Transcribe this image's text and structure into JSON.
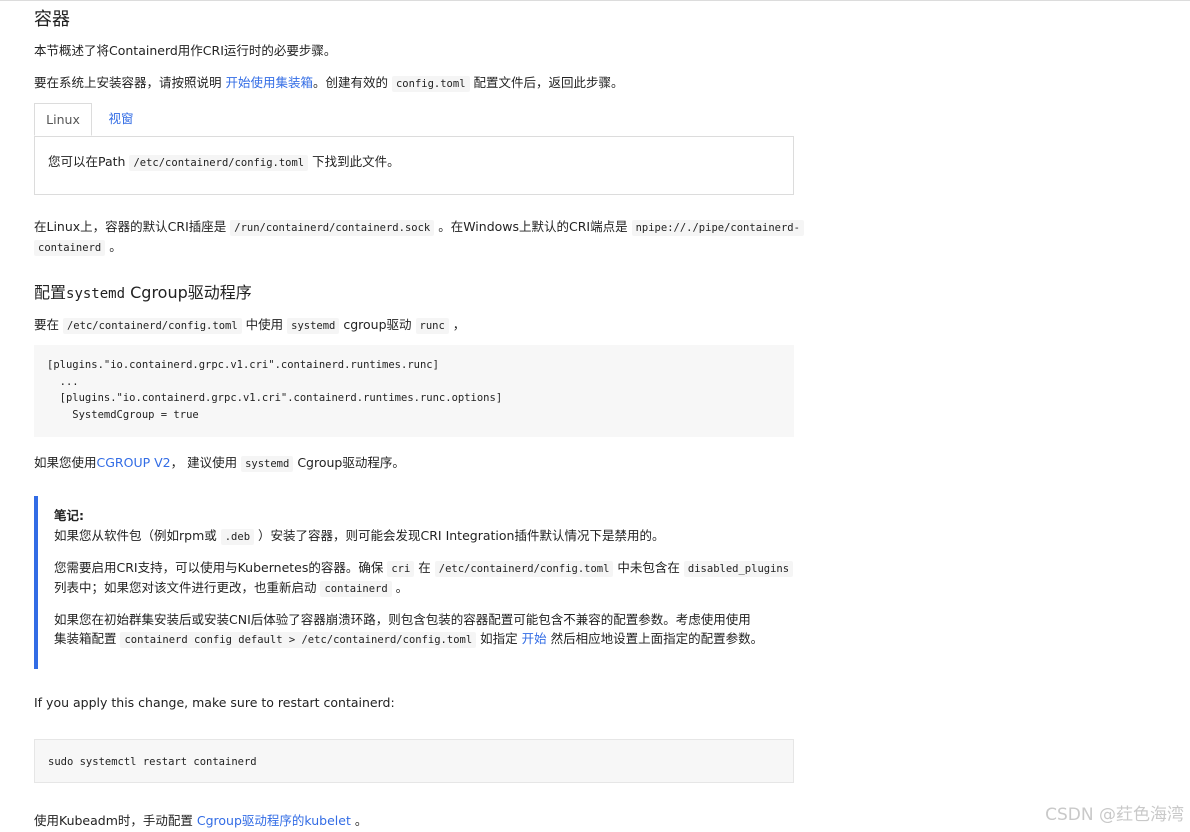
{
  "heading": "容器",
  "intro": "本节概述了将Containerd用作CRI运行时的必要步骤。",
  "install": {
    "before": "要在系统上安装容器，请按照说明 ",
    "link": "开始使用集装箱",
    "middle": "。创建有效的 ",
    "code": "config.toml",
    "after": " 配置文件后，返回此步骤。"
  },
  "tabs": [
    {
      "label": "Linux",
      "active": true
    },
    {
      "label": "视窗",
      "active": false
    }
  ],
  "tab_content": {
    "before": "您可以在Path ",
    "code": "/etc/containerd/config.toml",
    "after": " 下找到此文件。"
  },
  "endpoint": {
    "line1_before": "在Linux上，容器的默认CRI插座是 ",
    "line1_code1": "/run/containerd/containerd.sock",
    "line1_mid": " 。在Windows上默认的CRI端点是 ",
    "line1_code2": "npipe://./pipe/containerd-",
    "line2_code": "containerd",
    "line2_after": " 。"
  },
  "section": {
    "title_before": "配置",
    "title_code": "systemd",
    "title_after": " Cgroup驱动程序"
  },
  "usage": {
    "before": "要在 ",
    "code1": "/etc/containerd/config.toml",
    "mid1": " 中使用 ",
    "code2": "systemd",
    "mid2": " cgroup驱动 ",
    "code3": "runc",
    "after": " ，"
  },
  "code_block_1": [
    "[plugins.\"io.containerd.grpc.v1.cri\".containerd.runtimes.runc]",
    "  ...",
    "  [plugins.\"io.containerd.grpc.v1.cri\".containerd.runtimes.runc.options]",
    "    SystemdCgroup = true"
  ],
  "cgroupv2": {
    "before": "如果您使用",
    "link": "CGROUP V2",
    "mid": "， 建议使用 ",
    "code": "systemd",
    "after": " Cgroup驱动程序。"
  },
  "note": {
    "title": "笔记:",
    "p1_before": "如果您从软件包（例如rpm或 ",
    "p1_code": ".deb",
    "p1_after": " ）安装了容器，则可能会发现CRI Integration插件默认情况下是禁用的。",
    "p2_before": "您需要启用CRI支持，可以使用与Kubernetes的容器。确保 ",
    "p2_code1": "cri",
    "p2_mid1": " 在 ",
    "p2_code2": "/etc/containerd/config.toml",
    "p2_mid2": " 中未包含在 ",
    "p2_code3": "disabled_plugins",
    "p2_line2_before": "列表中；如果您对该文件进行更改，也重新启动 ",
    "p2_code4": "containerd",
    "p2_line2_after": " 。",
    "p3_line1": "如果您在初始群集安装后或安装CNI后体验了容器崩溃环路，则包含包装的容器配置可能包含不兼容的配置参数。考虑使用使用",
    "p3_line2_before": "集装箱配置 ",
    "p3_code": "containerd config default > /etc/containerd/config.toml",
    "p3_mid": " 如指定 ",
    "p3_link": "开始",
    "p3_after": " 然后相应地设置上面指定的配置参数。"
  },
  "restart_text": "If you apply this change, make sure to restart containerd:",
  "code_block_2": "sudo systemctl restart containerd",
  "kubeadm": {
    "before": "使用Kubeadm时，手动配置 ",
    "link": "Cgroup驱动程序的kubelet",
    "after": " 。"
  },
  "watermark": "CSDN @荭色海湾",
  "colors": {
    "link": "#326ce5",
    "note_border": "#326ce5",
    "code_bg": "#f7f7f7"
  }
}
